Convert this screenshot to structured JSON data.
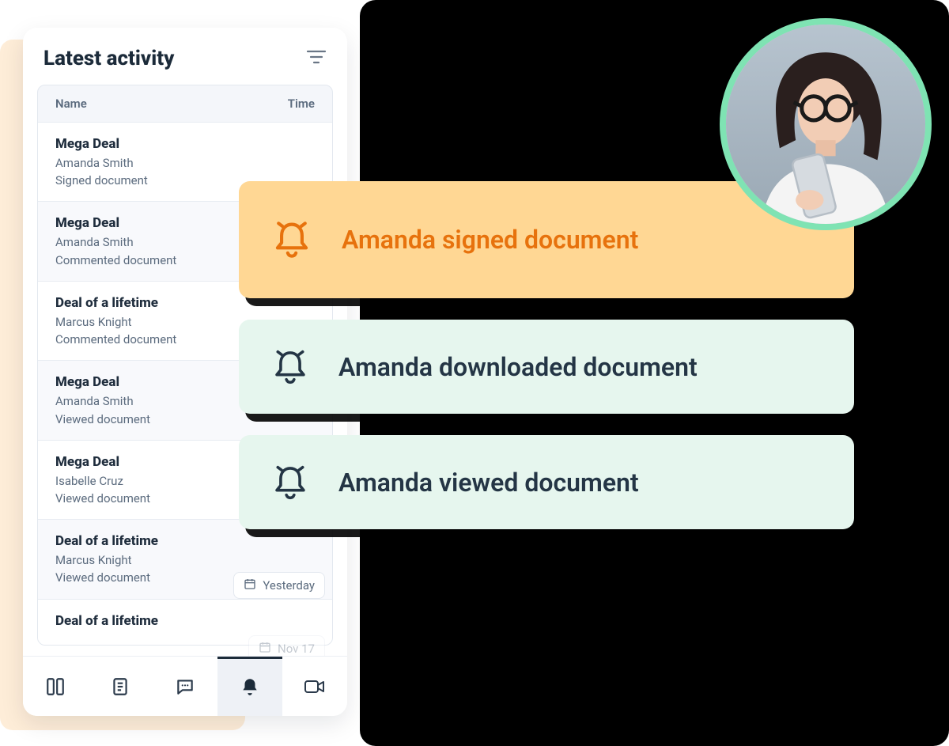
{
  "panel": {
    "title": "Latest activity",
    "columns": {
      "name": "Name",
      "time": "Time"
    },
    "items": [
      {
        "deal": "Mega Deal",
        "person": "Amanda Smith",
        "action": "Signed document"
      },
      {
        "deal": "Mega Deal",
        "person": "Amanda Smith",
        "action": "Commented document"
      },
      {
        "deal": "Deal of a lifetime",
        "person": "Marcus Knight",
        "action": "Commented document"
      },
      {
        "deal": "Mega Deal",
        "person": "Amanda Smith",
        "action": "Viewed document"
      },
      {
        "deal": "Mega Deal",
        "person": "Isabelle Cruz",
        "action": "Viewed document"
      },
      {
        "deal": "Deal of a lifetime",
        "person": "Marcus Knight",
        "action": "Viewed document"
      },
      {
        "deal": "Deal of a lifetime",
        "person": "",
        "action": ""
      }
    ],
    "date_chips": [
      "Yesterday",
      "Nov 17"
    ]
  },
  "toasts": [
    {
      "type": "orange",
      "text": "Amanda signed document"
    },
    {
      "type": "mint",
      "text": "Amanda downloaded document"
    },
    {
      "type": "mint",
      "text": "Amanda viewed document"
    }
  ],
  "nav": {
    "items": [
      "layout",
      "document",
      "chat",
      "bell",
      "video"
    ],
    "active_index": 3
  },
  "icons": {
    "filter": "filter-icon",
    "bell": "bell-icon",
    "calendar": "calendar-icon"
  }
}
